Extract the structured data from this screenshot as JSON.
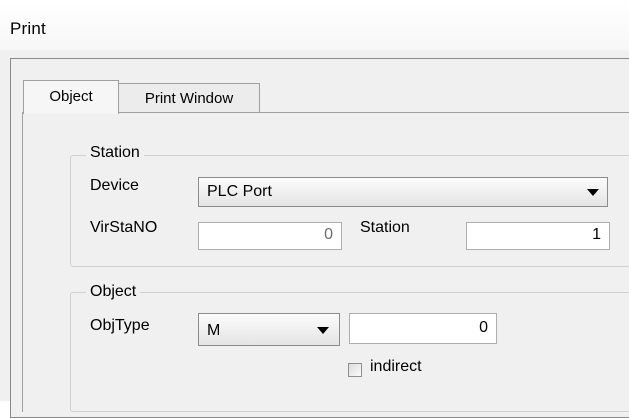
{
  "window": {
    "title": "Print"
  },
  "tabs": [
    {
      "label": "Object",
      "active": true
    },
    {
      "label": "Print Window",
      "active": false
    }
  ],
  "station_group": {
    "legend": "Station",
    "device_label": "Device",
    "device_value": "PLC Port",
    "virstano_label": "VirStaNO",
    "virstano_value": "0",
    "station_label": "Station",
    "station_value": "1"
  },
  "object_group": {
    "legend": "Object",
    "objtype_label": "ObjType",
    "objtype_value": "M",
    "address_value": "0",
    "indirect_label": "indirect",
    "indirect_checked": false
  }
}
